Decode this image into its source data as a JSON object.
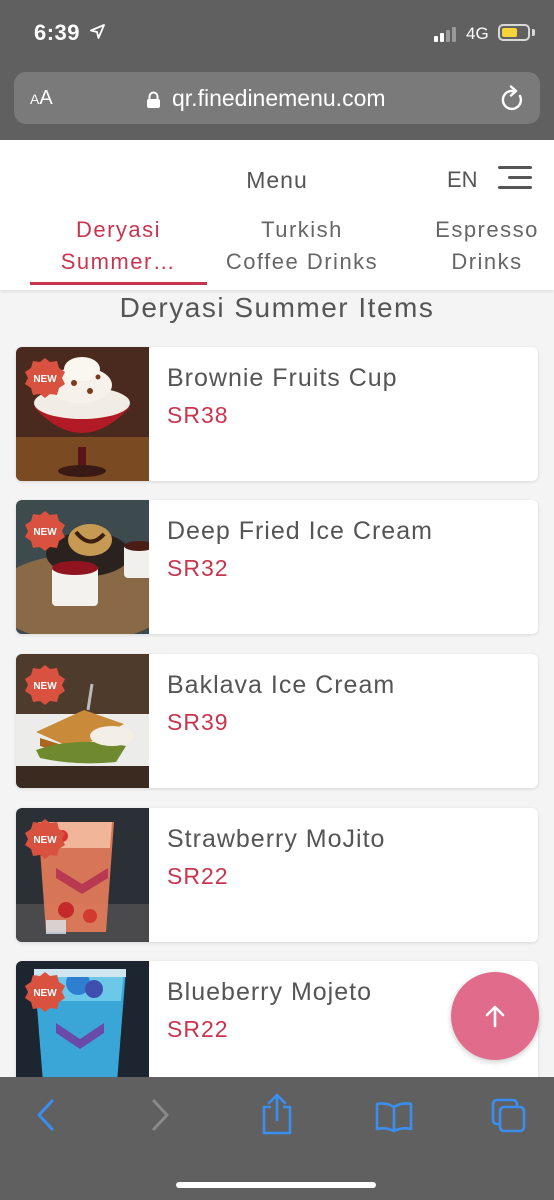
{
  "status": {
    "time": "6:39",
    "network": "4G"
  },
  "browser": {
    "text_size_label_small": "A",
    "text_size_label_large": "A",
    "url": "qr.finedinemenu.com"
  },
  "header": {
    "title": "Menu",
    "language": "EN"
  },
  "tabs": [
    {
      "line1": "Deryasi",
      "line2": "Summer…",
      "active": true
    },
    {
      "line1": "Turkish",
      "line2": "Coffee Drinks",
      "active": false
    },
    {
      "line1": "Espresso",
      "line2": "Drinks",
      "active": false
    }
  ],
  "section": {
    "title": "Deryasi Summer Items"
  },
  "items": [
    {
      "name": "Brownie Fruits Cup",
      "price": "SR38",
      "badge": "NEW"
    },
    {
      "name": "Deep Fried Ice Cream",
      "price": "SR32",
      "badge": "NEW"
    },
    {
      "name": "Baklava Ice Cream",
      "price": "SR39",
      "badge": "NEW"
    },
    {
      "name": "Strawberry MoJito",
      "price": "SR22",
      "badge": "NEW"
    },
    {
      "name": "Blueberry Mojeto",
      "price": "SR22",
      "badge": "NEW"
    }
  ],
  "colors": {
    "accent": "#c8354f",
    "fab": "#e06b8a",
    "browser_chrome": "#606060",
    "toolbar_icon": "#3b8ef0"
  },
  "icons": {
    "location": "location-arrow-icon",
    "lock": "lock-icon",
    "reload": "reload-icon",
    "menu": "hamburger-icon",
    "scroll_top": "arrow-up-icon",
    "back": "chevron-left-icon",
    "forward": "chevron-right-icon",
    "share": "share-icon",
    "bookmarks": "book-icon",
    "tabs": "tabs-icon"
  }
}
